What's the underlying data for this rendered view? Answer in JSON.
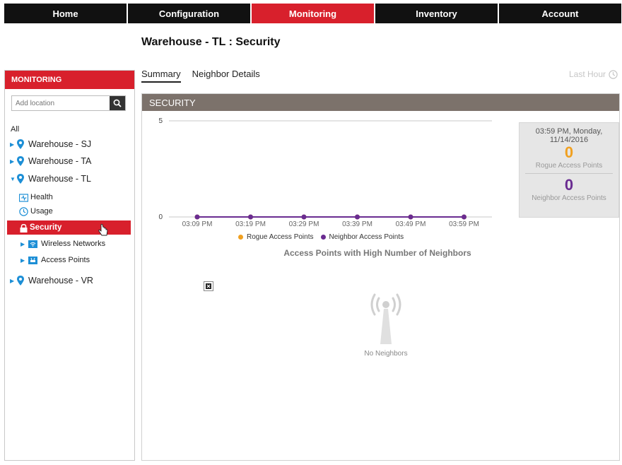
{
  "topnav": {
    "tabs": [
      {
        "label": "Home"
      },
      {
        "label": "Configuration"
      },
      {
        "label": "Monitoring"
      },
      {
        "label": "Inventory"
      },
      {
        "label": "Account"
      }
    ],
    "active": "Monitoring"
  },
  "page": {
    "title": "Warehouse - TL : Security"
  },
  "sidebar": {
    "header": "MONITORING",
    "search_placeholder": "Add location",
    "all_label": "All",
    "locations": [
      {
        "label": "Warehouse - SJ"
      },
      {
        "label": "Warehouse - TA"
      },
      {
        "label": "Warehouse - TL"
      },
      {
        "label": "Warehouse - VR"
      }
    ],
    "children": [
      {
        "label": "Health"
      },
      {
        "label": "Usage"
      },
      {
        "label": "Security"
      },
      {
        "label": "Wireless Networks"
      },
      {
        "label": "Access Points"
      }
    ]
  },
  "subtabs": [
    {
      "label": "Summary"
    },
    {
      "label": "Neighbor Details"
    }
  ],
  "time_range": "Last Hour",
  "panel": {
    "header": "SECURITY",
    "summary": {
      "timestamp": "03:59 PM, Monday, 11/14/2016",
      "rogue_count": "0",
      "rogue_label": "Rogue Access Points",
      "neighbor_count": "0",
      "neighbor_label": "Neighbor Access Points"
    },
    "chart2_title": "Access Points with High Number of Neighbors",
    "no_neighbors_text": "No Neighbors"
  },
  "colors": {
    "accent_red": "#d8202c",
    "rogue": "#f0a020",
    "neighbor": "#6a2c91",
    "header_gray": "#7c726b"
  },
  "chart_data": {
    "type": "line",
    "categories": [
      "03:09 PM",
      "03:19 PM",
      "03:29 PM",
      "03:39 PM",
      "03:49 PM",
      "03:59 PM"
    ],
    "series": [
      {
        "name": "Rogue Access Points",
        "values": [
          0,
          0,
          0,
          0,
          0,
          0
        ],
        "color": "#f0a020"
      },
      {
        "name": "Neighbor Access Points",
        "values": [
          0,
          0,
          0,
          0,
          0,
          0
        ],
        "color": "#6a2c91"
      }
    ],
    "yticks": [
      0,
      5
    ],
    "ylim": [
      0,
      5
    ],
    "legend": "bottom"
  }
}
